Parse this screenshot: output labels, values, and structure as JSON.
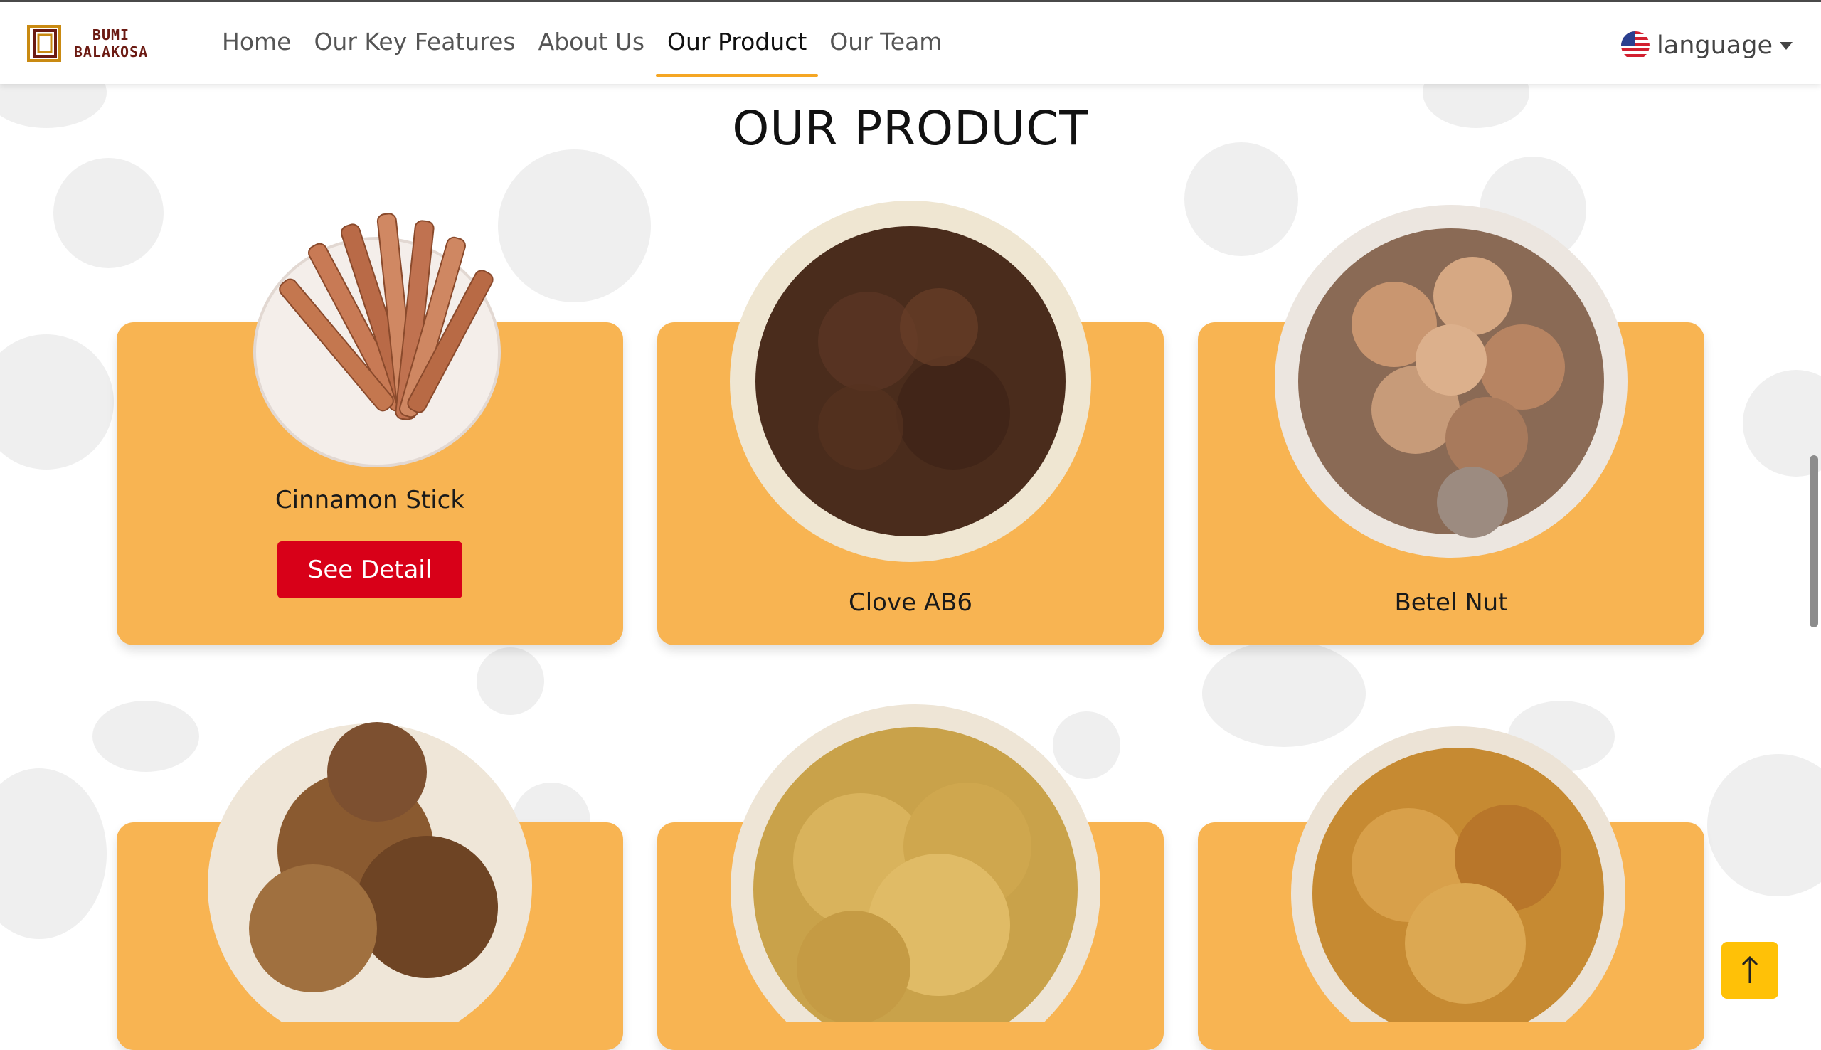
{
  "brand": {
    "line1": "BUMI",
    "line2": "BALAKOSA"
  },
  "nav": {
    "items": [
      {
        "label": "Home"
      },
      {
        "label": "Our Key Features"
      },
      {
        "label": "About Us"
      },
      {
        "label": "Our Product"
      },
      {
        "label": "Our Team"
      }
    ],
    "active_index": 3,
    "language_label": "language"
  },
  "section": {
    "title": "OUR PRODUCT"
  },
  "products": [
    {
      "name": "Cinnamon Stick",
      "button": "See Detail"
    },
    {
      "name": "Clove AB6"
    },
    {
      "name": "Betel Nut"
    },
    {
      "name": ""
    },
    {
      "name": ""
    },
    {
      "name": ""
    }
  ],
  "icons": {
    "logo": "logo-frame-icon",
    "flag": "us-flag-icon",
    "caret": "caret-down-icon",
    "back_to_top": "arrow-up-icon"
  },
  "colors": {
    "card": "#f8b452",
    "button": "#d80018",
    "active_underline": "#f5a623",
    "back_to_top": "#ffc107",
    "brand_text": "#6b1a12"
  }
}
